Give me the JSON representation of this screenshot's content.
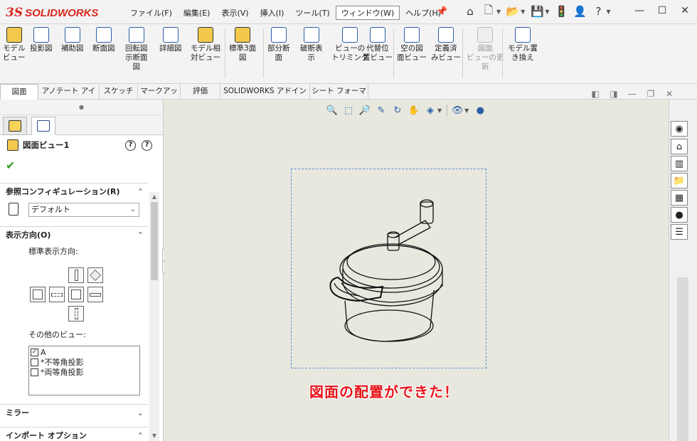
{
  "app": {
    "brand_prefix": "3S",
    "brand": "SOLIDWORKS"
  },
  "menu": [
    "ファイル(F)",
    "編集(E)",
    "表示(V)",
    "挿入(I)",
    "ツール(T)",
    "ウィンドウ(W)",
    "ヘルプ(H)"
  ],
  "menu_active_index": 5,
  "ribbon": {
    "buttons": [
      {
        "label": "モデル\nビュー"
      },
      {
        "label": "投影図"
      },
      {
        "label": "補助図"
      },
      {
        "label": "断面図"
      },
      {
        "label": "回転図\n示断面\n図"
      },
      {
        "label": "詳細図"
      },
      {
        "label": "モデル相\n対ビュー"
      },
      {
        "label": "標準3面\n図"
      },
      {
        "label": "部分断\n面"
      },
      {
        "label": "破断表\n示"
      },
      {
        "label": "ビューの\nトリミング"
      },
      {
        "label": "代替位\n置ビュー"
      },
      {
        "label": "空の図\n面ビュー"
      },
      {
        "label": "定義済\nみビュー"
      },
      {
        "label": "図面\nビューの更\n新"
      },
      {
        "label": "モデル置\nき換え"
      }
    ]
  },
  "tabs": [
    "図面",
    "アノテート アイテム",
    "スケッチ",
    "マークアップ",
    "評価",
    "SOLIDWORKS アドイン",
    "シート フォーマット"
  ],
  "tab_active_index": 0,
  "property_manager": {
    "title": "図面ビュー1",
    "sections": {
      "reference_config": {
        "title": "参照コンフィギュレーション(R)",
        "value": "デフォルト"
      },
      "orientation": {
        "title": "表示方向(O)",
        "standard_label": "標準表示方向:",
        "other_label": "その他のビュー:",
        "other_views": [
          {
            "label": "A",
            "checked": true
          },
          {
            "label": "*不等角投影",
            "checked": false
          },
          {
            "label": "*両等角投影",
            "checked": false
          }
        ]
      },
      "mirror": {
        "title": "ミラー"
      },
      "import": {
        "title": "インポート オプション"
      }
    }
  },
  "caption": "図面の配置ができた！"
}
